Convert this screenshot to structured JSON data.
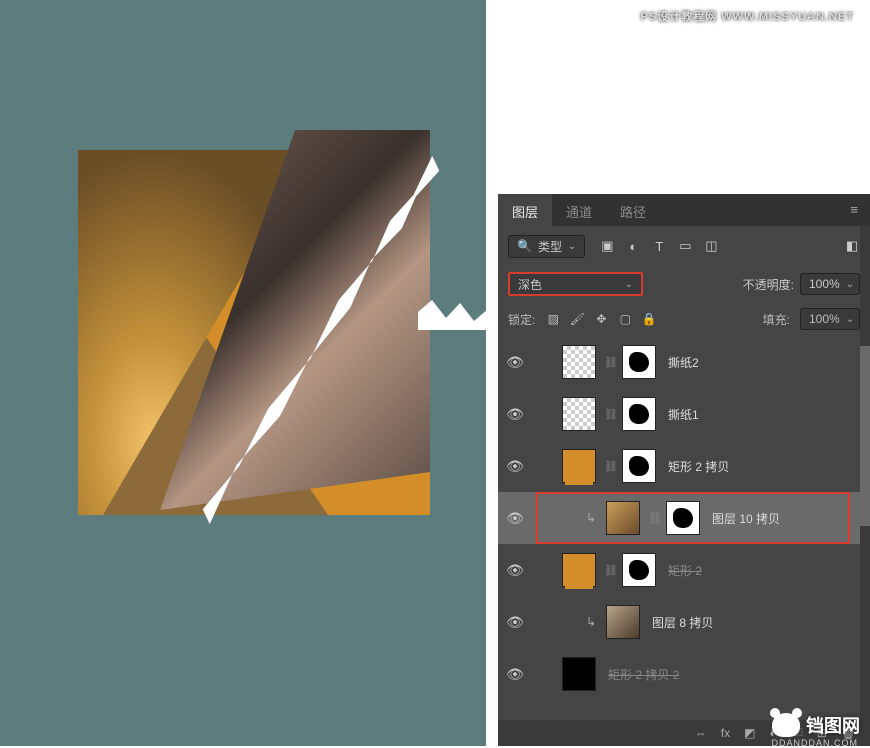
{
  "watermarks": {
    "top": "PS设计教程网  WWW.MISSYUAN.NET",
    "bottom": "铛图网",
    "bottom_sub": "DDANDDAN.COM"
  },
  "panel": {
    "tabs": {
      "layers": "图层",
      "channels": "通道",
      "paths": "路径"
    },
    "filter_label": "类型",
    "blend_mode": "深色",
    "opacity_label": "不透明度:",
    "opacity_value": "100%",
    "lock_label": "锁定:",
    "fill_label": "填充:",
    "fill_value": "100%",
    "icons": {
      "search": "search-icon",
      "image": "image-icon",
      "adjust": "adjust-icon",
      "type": "type-icon",
      "shape": "shape-icon",
      "smart": "smart-icon",
      "toggle": "toggle-icon",
      "menu": "menu-icon",
      "lock_trans": "lock-trans-icon",
      "lock_brush": "lock-brush-icon",
      "lock_move": "lock-move-icon",
      "lock_art": "lock-artboard-icon",
      "lock_all": "lock-all-icon",
      "link": "link-icon",
      "fx": "fx-icon",
      "mask": "add-mask-icon",
      "adjustment": "new-adjustment-icon",
      "group": "new-group-icon",
      "new": "new-layer-icon",
      "trash": "trash-icon"
    }
  },
  "layers": [
    {
      "name": "撕纸2",
      "indent": 1,
      "clip": false,
      "thumb": "trans",
      "mask": "blob",
      "visible": true,
      "strike": false
    },
    {
      "name": "撕纸1",
      "indent": 1,
      "clip": false,
      "thumb": "trans",
      "mask": "blob",
      "visible": true,
      "strike": false
    },
    {
      "name": "矩形 2 拷贝",
      "indent": 1,
      "clip": false,
      "thumb": "orange",
      "mask": "blob",
      "visible": true,
      "strike": false
    },
    {
      "name": "图层 10 拷贝",
      "indent": 2,
      "clip": true,
      "thumb": "photo1",
      "mask": "blob",
      "visible": true,
      "strike": false,
      "selected": true
    },
    {
      "name": "矩形 2",
      "indent": 1,
      "clip": false,
      "thumb": "orange",
      "mask": "blob",
      "visible": true,
      "strike": true
    },
    {
      "name": "图层 8 拷贝",
      "indent": 2,
      "clip": true,
      "thumb": "photo2",
      "mask": null,
      "visible": true,
      "strike": false
    },
    {
      "name": "矩形 2 拷贝 2",
      "indent": 1,
      "clip": false,
      "thumb": "black",
      "mask": null,
      "visible": true,
      "strike": true
    }
  ]
}
